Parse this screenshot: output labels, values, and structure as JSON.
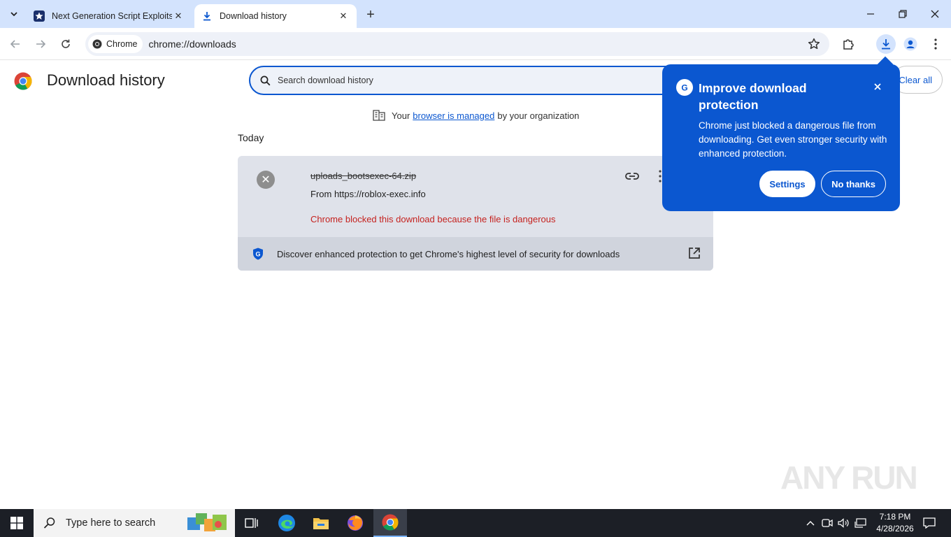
{
  "browser": {
    "tabs": [
      {
        "title": "Next Generation Script Exploits",
        "active": false
      },
      {
        "title": "Download history",
        "active": true
      }
    ],
    "chip_label": "Chrome",
    "url": "chrome://downloads"
  },
  "page": {
    "title": "Download history",
    "search_placeholder": "Search download history",
    "clear_all": "Clear all",
    "managed_prefix": "Your",
    "managed_link": "browser is managed",
    "managed_suffix": "by your organization",
    "section_label": "Today"
  },
  "download": {
    "file_name": "uploads_bootsexec-64.zip",
    "source": "From https://roblox-exec.info",
    "status": "Chrome blocked this download because the file is dangerous",
    "footer_text": "Discover enhanced protection to get Chrome's highest level of security for downloads"
  },
  "bubble": {
    "title": "Improve download protection",
    "body": "Chrome just blocked a dangerous file from downloading. Get even stronger security with enhanced protection.",
    "settings_label": "Settings",
    "no_thanks_label": "No thanks"
  },
  "watermark": "ANY RUN",
  "taskbar": {
    "search_placeholder": "Type here to search",
    "time": "7:18 PM",
    "date": "4/28/2026"
  },
  "colors": {
    "accent": "#0b57d0",
    "danger": "#c5221f",
    "tabstrip": "#d3e3fd"
  }
}
